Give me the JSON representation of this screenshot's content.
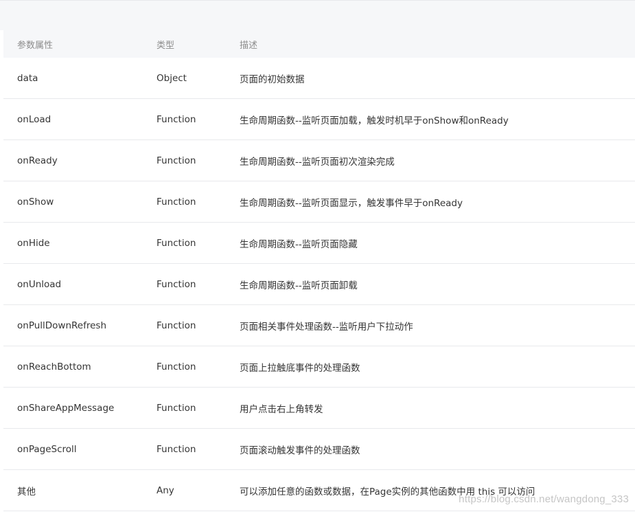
{
  "table": {
    "headers": [
      "参数属性",
      "类型",
      "描述"
    ],
    "rows": [
      {
        "name": "data",
        "type": "Object",
        "desc": "页面的初始数据"
      },
      {
        "name": "onLoad",
        "type": "Function",
        "desc": "生命周期函数--监听页面加载，触发时机早于onShow和onReady"
      },
      {
        "name": "onReady",
        "type": "Function",
        "desc": "生命周期函数--监听页面初次渲染完成"
      },
      {
        "name": "onShow",
        "type": "Function",
        "desc": "生命周期函数--监听页面显示，触发事件早于onReady"
      },
      {
        "name": "onHide",
        "type": "Function",
        "desc": "生命周期函数--监听页面隐藏"
      },
      {
        "name": "onUnload",
        "type": "Function",
        "desc": "生命周期函数--监听页面卸载"
      },
      {
        "name": "onPullDownRefresh",
        "type": "Function",
        "desc": "页面相关事件处理函数--监听用户下拉动作"
      },
      {
        "name": "onReachBottom",
        "type": "Function",
        "desc": "页面上拉触底事件的处理函数"
      },
      {
        "name": "onShareAppMessage",
        "type": "Function",
        "desc": "用户点击右上角转发"
      },
      {
        "name": "onPageScroll",
        "type": "Function",
        "desc": "页面滚动触发事件的处理函数"
      },
      {
        "name": "其他",
        "type": "Any",
        "desc": "可以添加任意的函数或数据，在Page实例的其他函数中用 this 可以访问"
      }
    ]
  },
  "watermark": "https://blog.csdn.net/wangdong_333"
}
